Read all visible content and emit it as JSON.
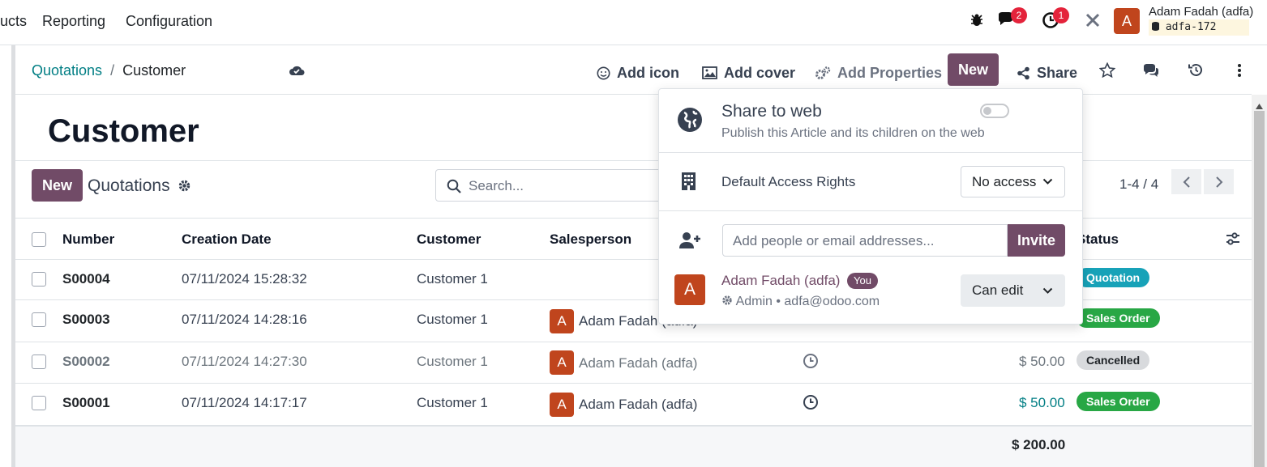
{
  "topbar": {
    "menu": [
      "ucts",
      "Reporting",
      "Configuration"
    ],
    "messages_count": "2",
    "activities_count": "1",
    "user_initial": "A",
    "user_name": "Adam Fadah (adfa)",
    "database": "adfa-172",
    "icons": [
      "bug-icon",
      "chat-icon",
      "clock-icon",
      "tools-icon"
    ]
  },
  "control": {
    "breadcrumb_parent": "Quotations",
    "breadcrumb_sep": "/",
    "breadcrumb_current": "Customer",
    "add_icon": "Add icon",
    "add_cover": "Add cover",
    "add_properties": "Add Properties",
    "new": "New",
    "share": "Share"
  },
  "article": {
    "title": "Customer"
  },
  "embedded_view": {
    "new": "New",
    "title": "Quotations",
    "search_placeholder": "Search...",
    "pager": "1-4 / 4"
  },
  "table": {
    "headers": [
      "Number",
      "Creation Date",
      "Customer",
      "Salesperson",
      "Status"
    ],
    "rows": [
      {
        "number": "S00004",
        "date": "07/11/2024 15:28:32",
        "customer": "Customer 1",
        "salesperson": "",
        "amount": "",
        "status": "Quotation",
        "status_type": "info"
      },
      {
        "number": "S00003",
        "date": "07/11/2024 14:28:16",
        "customer": "Customer 1",
        "salesperson": "Adam Fadah (adfa)",
        "amount": "",
        "status": "Sales Order",
        "status_type": "success"
      },
      {
        "number": "S00002",
        "date": "07/11/2024 14:27:30",
        "customer": "Customer 1",
        "salesperson": "Adam Fadah (adfa)",
        "amount": "$ 50.00",
        "status": "Cancelled",
        "status_type": "cancel"
      },
      {
        "number": "S00001",
        "date": "07/11/2024 14:17:17",
        "customer": "Customer 1",
        "salesperson": "Adam Fadah (adfa)",
        "amount": "$ 50.00",
        "status": "Sales Order",
        "status_type": "success"
      }
    ],
    "total": "$ 200.00"
  },
  "share_popover": {
    "web_title": "Share to web",
    "web_subtitle": "Publish this Article and its children on the web",
    "access_label": "Default Access Rights",
    "access_value": "No access",
    "invite_placeholder": "Add people or email addresses...",
    "invite_button": "Invite",
    "member_initial": "A",
    "member_name": "Adam Fadah (adfa)",
    "member_badge": "You",
    "member_detail": "Admin • adfa@odoo.com",
    "member_permission": "Can edit"
  },
  "colors": {
    "brand": "#714b67",
    "link": "#017e84",
    "avatar": "#c0451d",
    "info": "#17a2b8",
    "success": "#28a745"
  }
}
